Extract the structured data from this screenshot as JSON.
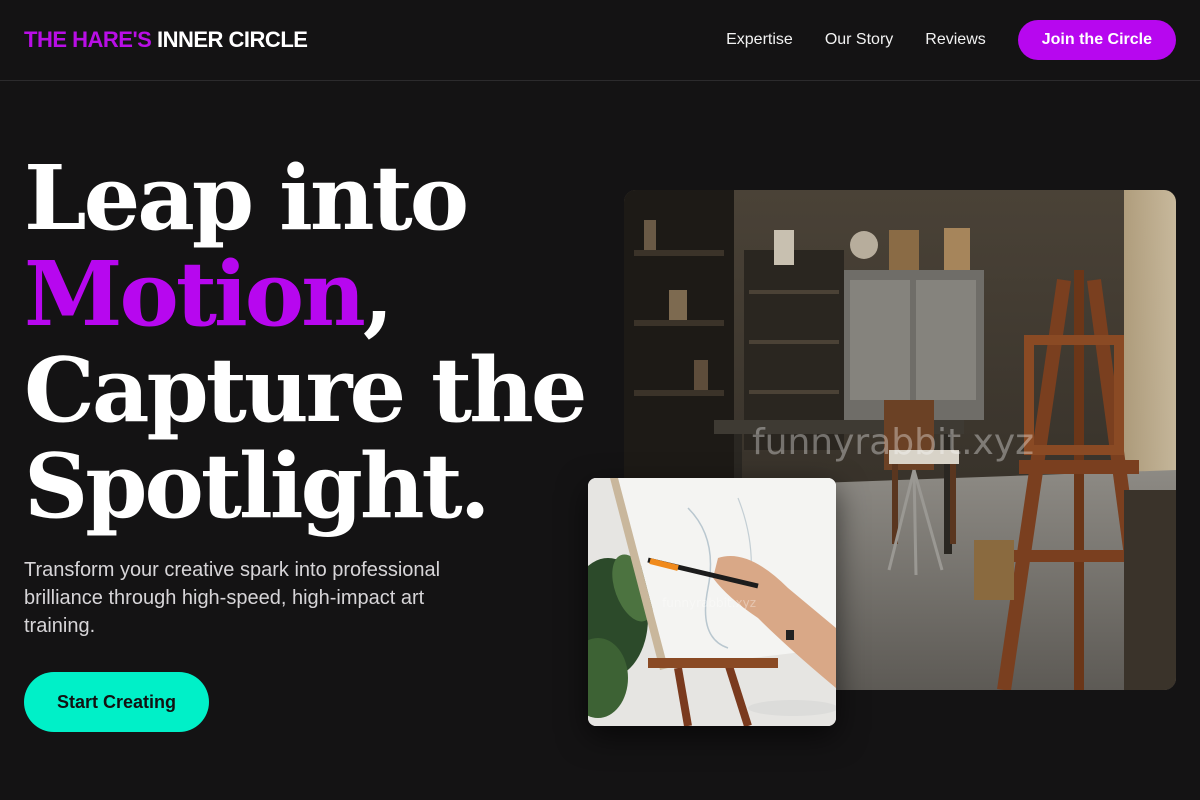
{
  "header": {
    "logo_accent": "THE HARE'S",
    "logo_rest": "INNER CIRCLE",
    "nav": [
      {
        "label": "Expertise"
      },
      {
        "label": "Our Story"
      },
      {
        "label": "Reviews"
      }
    ],
    "cta_label": "Join the Circle"
  },
  "hero": {
    "title_line1": "Leap into",
    "title_motion": "Motion",
    "title_comma": ",",
    "title_line3": "Capture the",
    "title_line4": "Spotlight.",
    "subtitle": "Transform your creative spark into professional brilliance through high-speed, high-impact art training.",
    "cta_label": "Start Creating"
  },
  "images": {
    "studio_watermark": "funnyrabbit.xyz",
    "painter_watermark": "funnyrabbit.xyz"
  },
  "colors": {
    "background": "#141314",
    "accent_purple": "#b707ef",
    "accent_teal": "#00f0c8"
  }
}
